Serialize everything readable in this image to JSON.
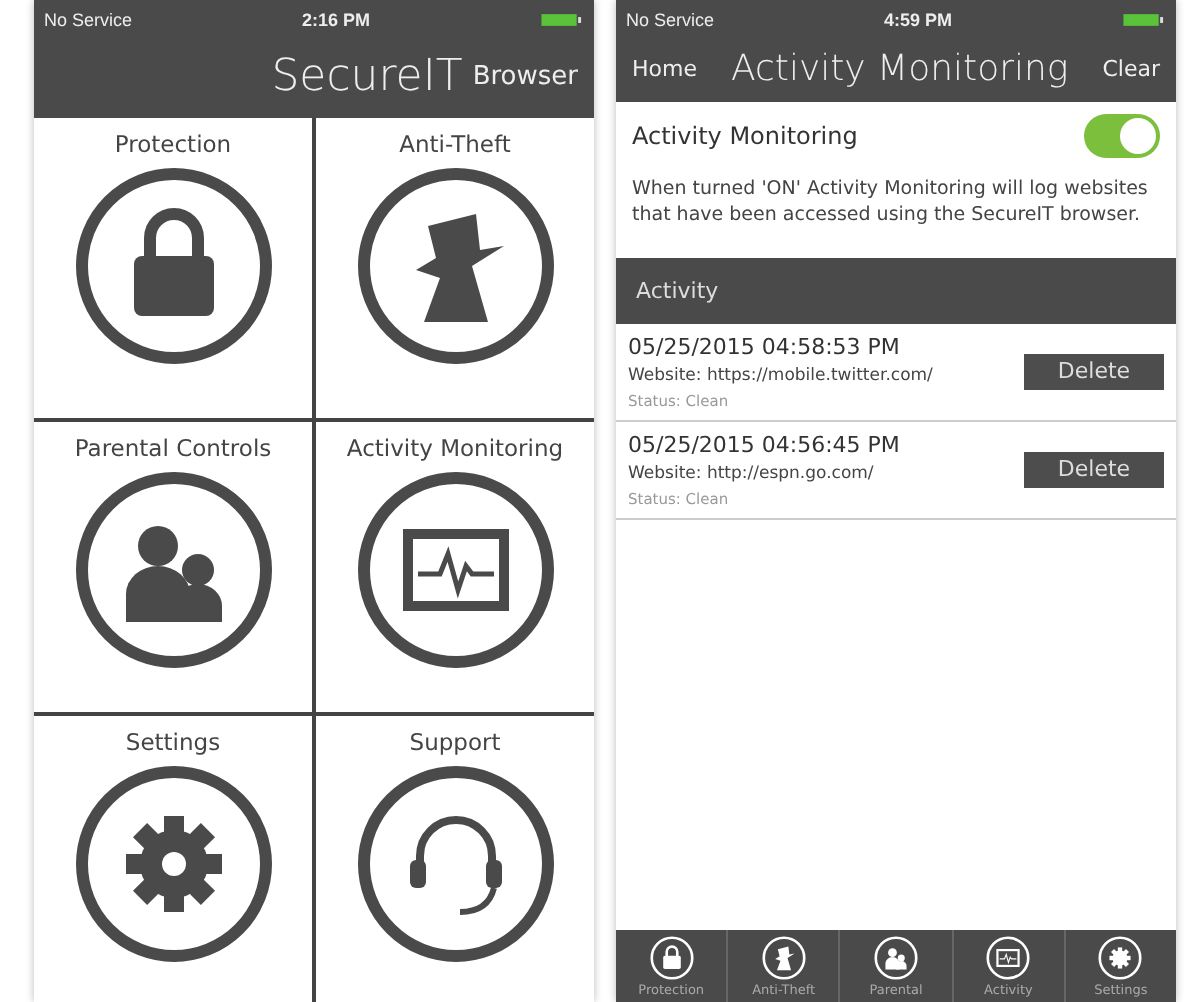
{
  "home_screen": {
    "status_bar": {
      "carrier": "No Service",
      "time": "2:16 PM"
    },
    "title": "SecureIT",
    "nav_action": "Browser",
    "tiles": [
      {
        "label": "Protection",
        "kind": "lock"
      },
      {
        "label": "Anti-Theft",
        "kind": "spy"
      },
      {
        "label": "Parental Controls",
        "kind": "family"
      },
      {
        "label": "Activity Monitoring",
        "kind": "monitor"
      },
      {
        "label": "Settings",
        "kind": "gear"
      },
      {
        "label": "Support",
        "kind": "headset"
      }
    ]
  },
  "activity_screen": {
    "status_bar": {
      "carrier": "No Service",
      "time": "4:59 PM"
    },
    "back": "Home",
    "title": "Activity Monitoring",
    "nav_action": "Clear",
    "monitoring": {
      "label": "Activity Monitoring",
      "on": true,
      "description": "When turned 'ON' Activity Monitoring will log websites that have been accessed using the SecureIT browser."
    },
    "section_header": "Activity",
    "entries": [
      {
        "timestamp": "05/25/2015 04:58:53 PM",
        "website": "Website: https://mobile.twitter.com/",
        "status": "Status: Clean",
        "action": "Delete"
      },
      {
        "timestamp": "05/25/2015 04:56:45 PM",
        "website": "Website: http://espn.go.com/",
        "status": "Status: Clean",
        "action": "Delete"
      }
    ],
    "tab_bar": [
      {
        "label": "Protection",
        "kind": "lock"
      },
      {
        "label": "Anti-Theft",
        "kind": "spy"
      },
      {
        "label": "Parental",
        "kind": "family"
      },
      {
        "label": "Activity",
        "kind": "monitor"
      },
      {
        "label": "Settings",
        "kind": "gear"
      }
    ]
  }
}
